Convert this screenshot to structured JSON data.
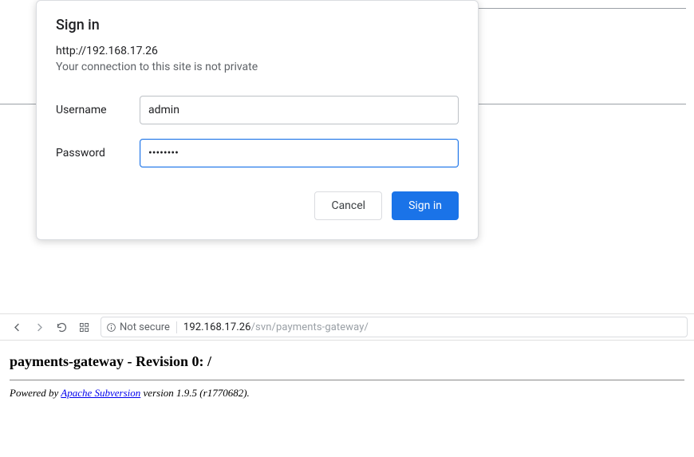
{
  "dialog": {
    "title": "Sign in",
    "url": "http://192.168.17.26",
    "warning": "Your connection to this site is not private",
    "username_label": "Username",
    "username_value": "admin",
    "password_label": "Password",
    "password_value": "••••••••",
    "cancel_label": "Cancel",
    "signin_label": "Sign in"
  },
  "toolbar": {
    "security_label": "Not secure",
    "url_host": "192.168.17.26",
    "url_path": "/svn/payments-gateway/"
  },
  "page": {
    "heading": "payments-gateway - Revision 0: /",
    "footer_prefix": "Powered by ",
    "footer_link": "Apache Subversion",
    "footer_suffix": " version 1.9.5 (r1770682)."
  }
}
